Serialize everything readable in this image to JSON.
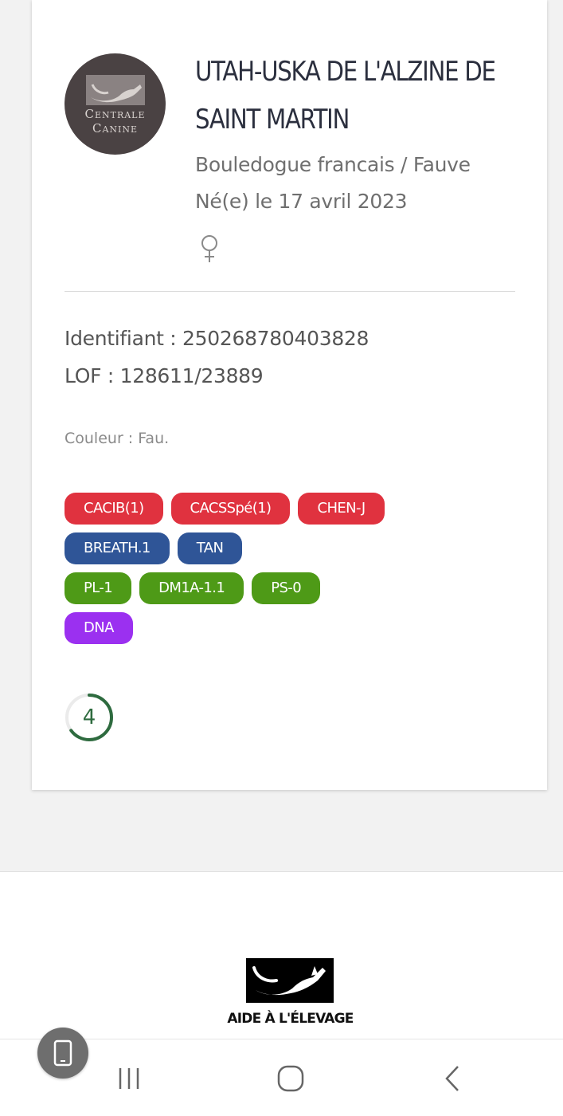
{
  "dog": {
    "name_line1": "UTAH-USKA DE L'ALZINE DE",
    "name_line2": "SAINT MARTIN",
    "breed": "Bouledogue francais / Fauve",
    "born": "Né(e) le 17 avril 2023",
    "sex_icon": "female-symbol-icon",
    "identifiant": "Identifiant : 250268780403828",
    "lof": "LOF : 128611/23889",
    "couleur": "Couleur : Fau.",
    "score": "4",
    "score_progress": 0.65
  },
  "logo": {
    "line1": "Centrale",
    "line2": "Canine"
  },
  "badges": {
    "row1": [
      "CACIB(1)",
      "CACSSpé(1)",
      "CHEN-J"
    ],
    "row2": [
      "BREATH.1",
      "TAN"
    ],
    "row3": [
      "PL-1",
      "DM1A-1.1",
      "PS-0"
    ],
    "row4": [
      "DNA"
    ]
  },
  "colors": {
    "red": "#e0323f",
    "blue": "#2f5597",
    "green": "#4e9a17",
    "purple": "#9b30f0",
    "score_ring": "#2e6b3f"
  },
  "footer": {
    "label": "AIDE À L'ÉLEVAGE"
  },
  "navbar": {
    "recent_icon": "recent-apps-icon",
    "home_icon": "home-icon",
    "back_icon": "back-icon",
    "floating_icon": "phone-icon"
  }
}
